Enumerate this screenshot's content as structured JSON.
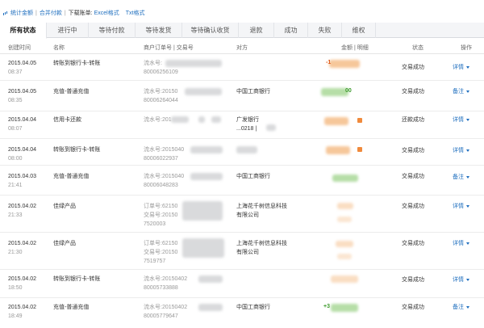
{
  "toolbar": {
    "stats_label": "统计金额",
    "merge_label": "合并付款",
    "download_label": "下载账单:",
    "excel_label": "Excel格式",
    "txt_label": "Txt格式"
  },
  "tabs": [
    "所有状态",
    "进行中",
    "等待付款",
    "等待发货",
    "等待确认收货",
    "退款",
    "成功",
    "失败",
    "维权"
  ],
  "columns": {
    "created": "创建时间",
    "name": "名称",
    "order": "商户订单号 | 交易号",
    "party": "对方",
    "amount": "金额 | 明细",
    "status": "状态",
    "op": "操作"
  },
  "rows": [
    {
      "date": "2015.04.05",
      "time": "08:37",
      "name": "转账到银行卡-转账",
      "order1": "流水号:",
      "order2": "80006256109",
      "order3": "",
      "party1": "",
      "party2": "",
      "amount": "-1",
      "status": "交易成功",
      "op": "详情"
    },
    {
      "date": "2015.04.05",
      "time": "08:35",
      "name": "充值-普通充值",
      "order1": "流水号:20150",
      "order2": "80006264044",
      "order3": "",
      "party1": "中国工商银行",
      "party2": "",
      "amount": "00",
      "status": "交易成功",
      "op": "备注"
    },
    {
      "date": "2015.04.04",
      "time": "08:07",
      "name": "信用卡还款",
      "order1": "流水号:201",
      "order2": "",
      "order3": "",
      "party1": "广发银行",
      "party2": "...0218 |",
      "amount": "",
      "status": "还款成功",
      "op": "详情"
    },
    {
      "date": "2015.04.04",
      "time": "08:00",
      "name": "转账到银行卡-转账",
      "order1": "流水号:2015040",
      "order2": "80006022937",
      "order3": "",
      "party1": "",
      "party2": "",
      "amount": "",
      "status": "交易成功",
      "op": "详情"
    },
    {
      "date": "2015.04.03",
      "time": "21:41",
      "name": "充值-普通充值",
      "order1": "流水号:2015040",
      "order2": "80006048283",
      "order3": "",
      "party1": "中国工商银行",
      "party2": "",
      "amount": "",
      "status": "交易成功",
      "op": "备注"
    },
    {
      "date": "2015.04.02",
      "time": "21:33",
      "name": "佳绿产品",
      "order1": "订单号:62150",
      "order2": "交易号:20150",
      "order3": "7520003",
      "party1": "上海花千树信息科技",
      "party2": "有限公司",
      "amount": "",
      "status": "交易成功",
      "op": "详情"
    },
    {
      "date": "2015.04.02",
      "time": "21:30",
      "name": "佳绿产品",
      "order1": "订单号:62150",
      "order2": "交易号:20150",
      "order3": "7519757",
      "party1": "上海花千树信息科技",
      "party2": "有限公司",
      "amount": "",
      "status": "交易成功",
      "op": "详情"
    },
    {
      "date": "2015.04.02",
      "time": "18:50",
      "name": "转账到银行卡-转账",
      "order1": "流水号:20150402",
      "order2": "80005733888",
      "order3": "",
      "party1": "",
      "party2": "",
      "amount": "",
      "status": "交易成功",
      "op": "详情"
    },
    {
      "date": "2015.04.02",
      "time": "18:49",
      "name": "充值-普通充值",
      "order1": "流水号:20150402",
      "order2": "80005779647",
      "order3": "",
      "party1": "中国工商银行",
      "party2": "",
      "amount": "+3",
      "status": "交易成功",
      "op": "备注"
    }
  ]
}
